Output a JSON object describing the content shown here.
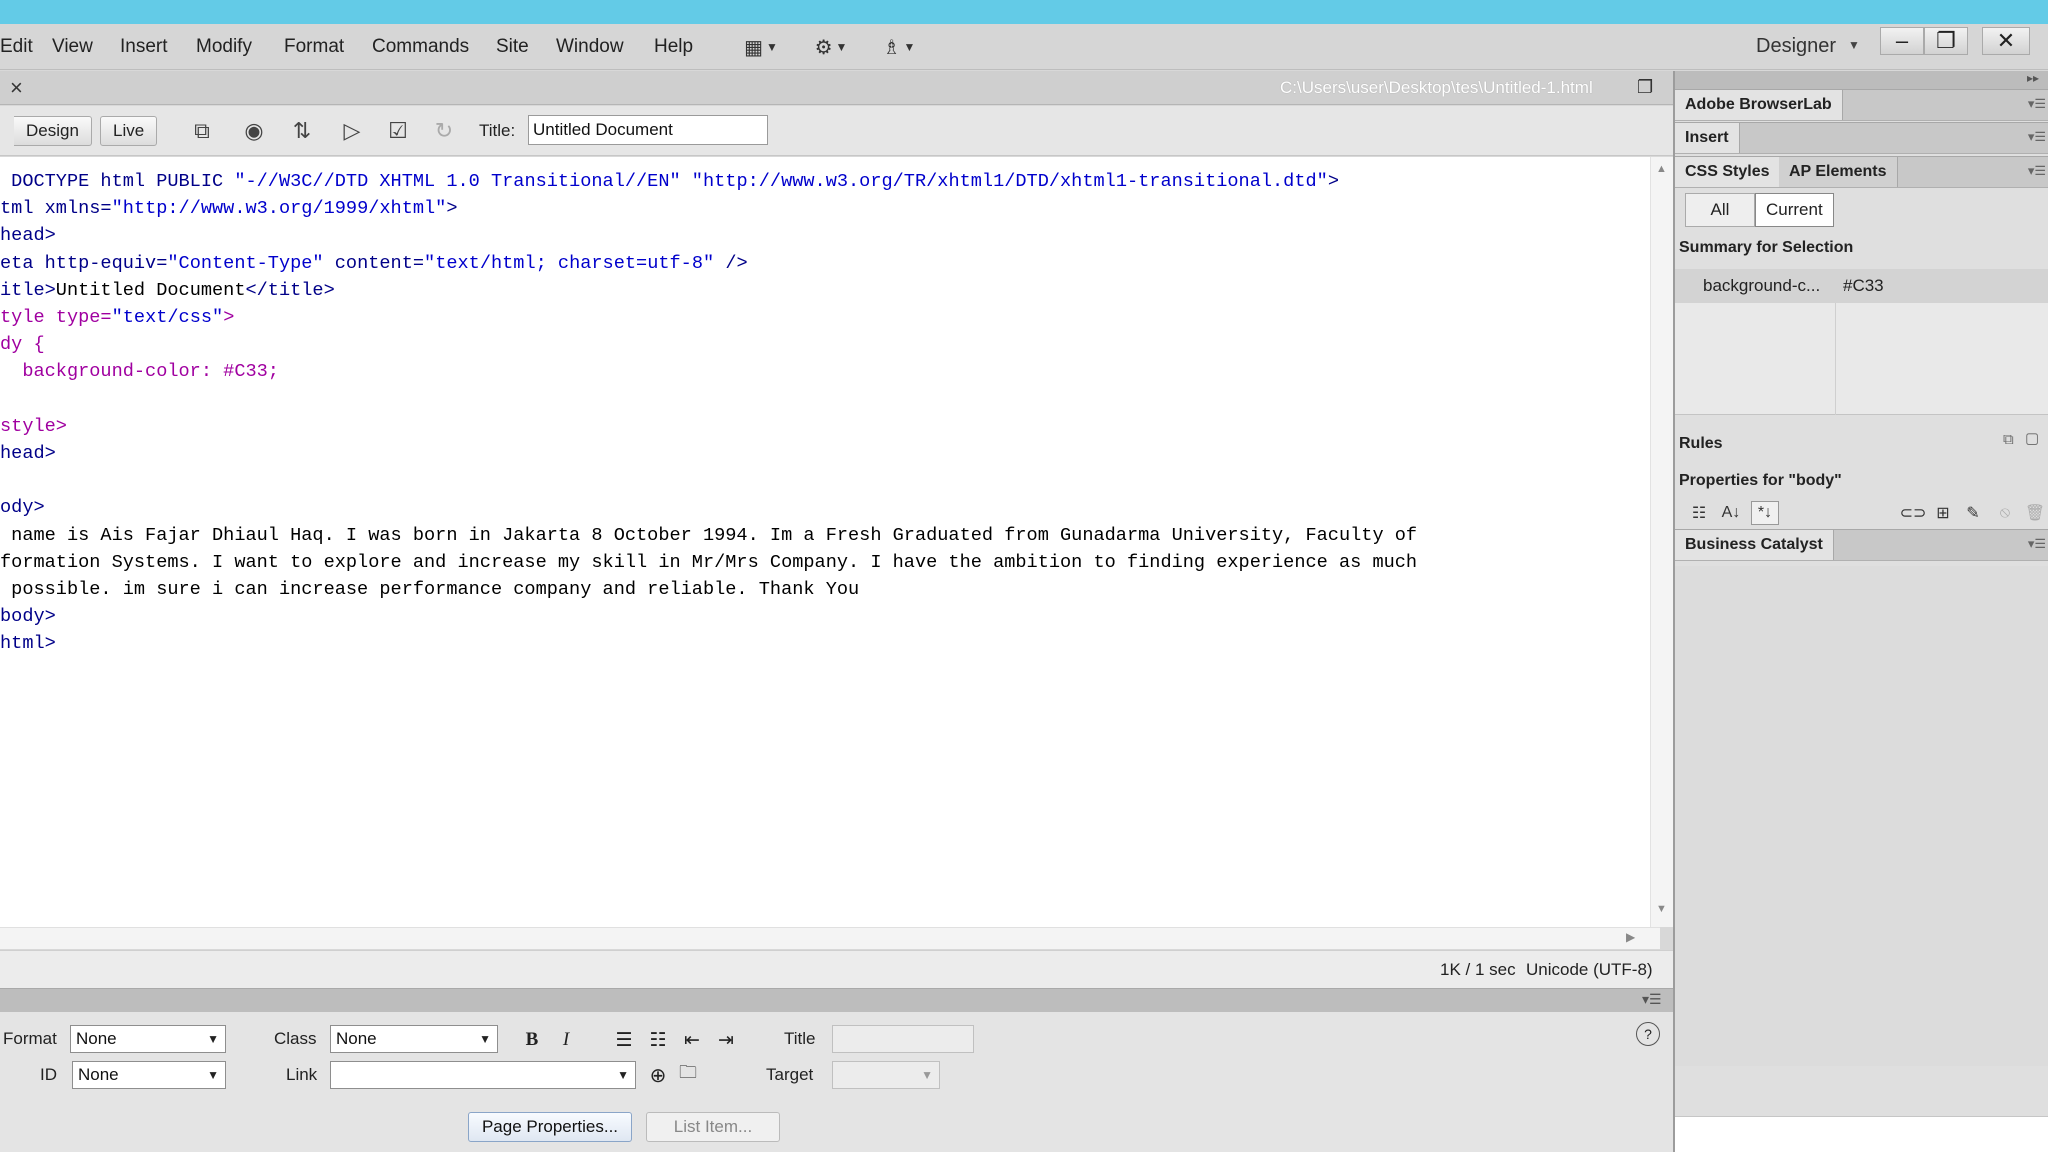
{
  "menu": {
    "items": [
      "Edit",
      "View",
      "Insert",
      "Modify",
      "Format",
      "Commands",
      "Site",
      "Window",
      "Help"
    ],
    "workspace": "Designer"
  },
  "toolbar_icons": [
    "layout-icon",
    "gear-icon",
    "site-icon"
  ],
  "window_controls": {
    "minimize": "–",
    "restore": "❐",
    "close": "✕"
  },
  "document": {
    "close": "×",
    "path": "C:\\Users\\user\\Desktop\\tes\\Untitled-1.html",
    "views": {
      "design": "Design",
      "live": "Live"
    },
    "title_label": "Title:",
    "title_value": "Untitled Document"
  },
  "code": {
    "lines": [
      [
        {
          "c": "tag",
          "t": " DOCTYPE html PUBLIC "
        },
        {
          "c": "str",
          "t": "\"-//W3C//DTD XHTML 1.0 Transitional//EN\" \"http://www.w3.org/TR/xhtml1/DTD/xhtml1-transitional.dtd\""
        },
        {
          "c": "tag",
          "t": ">"
        }
      ],
      [
        {
          "c": "tag",
          "t": "tml xmlns="
        },
        {
          "c": "str",
          "t": "\"http://www.w3.org/1999/xhtml\""
        },
        {
          "c": "tag",
          "t": ">"
        }
      ],
      [
        {
          "c": "tag",
          "t": "head>"
        }
      ],
      [
        {
          "c": "tag",
          "t": "eta http-equiv="
        },
        {
          "c": "str",
          "t": "\"Content-Type\""
        },
        {
          "c": "tag",
          "t": " content="
        },
        {
          "c": "str",
          "t": "\"text/html; charset=utf-8\""
        },
        {
          "c": "tag",
          "t": " />"
        }
      ],
      [
        {
          "c": "tag",
          "t": "itle>"
        },
        {
          "c": "txt",
          "t": "Untitled Document"
        },
        {
          "c": "tag",
          "t": "</title>"
        }
      ],
      [
        {
          "c": "css",
          "t": "tyle type="
        },
        {
          "c": "str",
          "t": "\"text/css\""
        },
        {
          "c": "css",
          "t": ">"
        }
      ],
      [
        {
          "c": "css",
          "t": "dy {"
        }
      ],
      [
        {
          "c": "css",
          "t": "  background-color: #C33;"
        }
      ],
      [
        {
          "c": "txt",
          "t": ""
        }
      ],
      [
        {
          "c": "css",
          "t": "style>"
        }
      ],
      [
        {
          "c": "tag",
          "t": "head>"
        }
      ],
      [
        {
          "c": "txt",
          "t": ""
        }
      ],
      [
        {
          "c": "tag",
          "t": "ody>"
        }
      ],
      [
        {
          "c": "txt",
          "t": " name is Ais Fajar Dhiaul Haq. I was born in Jakarta 8 October 1994. Im a Fresh Graduated from Gunadarma University, Faculty of"
        }
      ],
      [
        {
          "c": "txt",
          "t": "formation Systems. I want to explore and increase my skill in Mr/Mrs Company. I have the ambition to finding experience as much"
        }
      ],
      [
        {
          "c": "txt",
          "t": " possible. im sure i can increase performance company and reliable. Thank You"
        }
      ],
      [
        {
          "c": "tag",
          "t": "body>"
        }
      ],
      [
        {
          "c": "tag",
          "t": "html>"
        }
      ]
    ]
  },
  "status": {
    "size": "1K / 1 sec",
    "encoding": "Unicode (UTF-8)"
  },
  "properties": {
    "format_label": "Format",
    "format_value": "None",
    "id_label": "ID",
    "id_value": "None",
    "class_label": "Class",
    "class_value": "None",
    "link_label": "Link",
    "link_value": "",
    "title_label": "Title",
    "title_value": "",
    "target_label": "Target",
    "target_value": "",
    "bold": "B",
    "italic": "I",
    "page_properties": "Page Properties...",
    "list_item": "List Item...",
    "help": "?"
  },
  "panels": {
    "browserlab": "Adobe BrowserLab",
    "insert": "Insert",
    "css_styles": "CSS Styles",
    "ap_elements": "AP Elements",
    "all": "All",
    "current": "Current",
    "summary_title": "Summary for Selection",
    "summary_property": "background-c...",
    "summary_value": "#C33",
    "rules": "Rules",
    "properties_for": "Properties for \"body\"",
    "business_catalyst": "Business Catalyst"
  }
}
